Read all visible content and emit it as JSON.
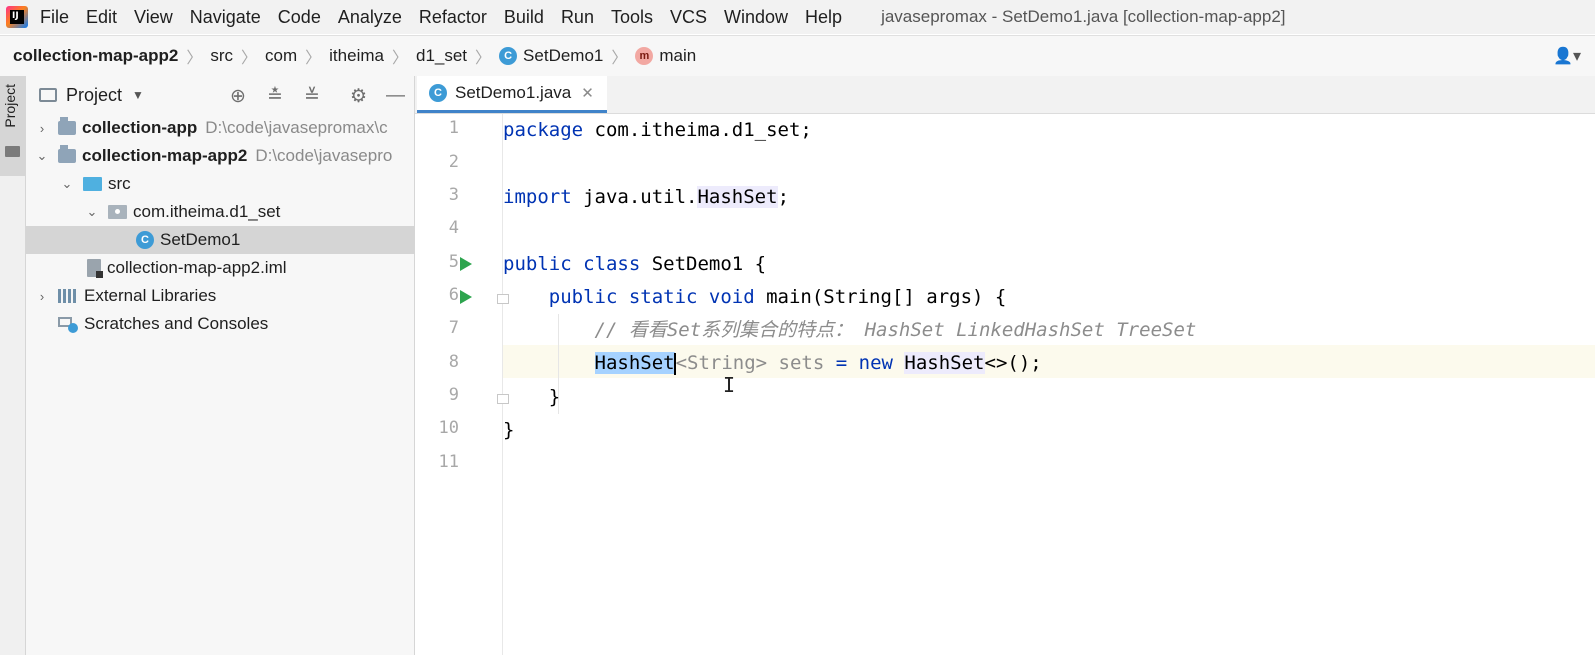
{
  "menubar": {
    "items": [
      "File",
      "Edit",
      "View",
      "Navigate",
      "Code",
      "Analyze",
      "Refactor",
      "Build",
      "Run",
      "Tools",
      "VCS",
      "Window",
      "Help"
    ],
    "window_title": "javasepromax - SetDemo1.java [collection-map-app2]"
  },
  "breadcrumb": {
    "items": [
      "collection-map-app2",
      "src",
      "com",
      "itheima",
      "d1_set",
      "SetDemo1",
      "main"
    ],
    "class_icon_letter": "C",
    "method_icon_letter": "m"
  },
  "tool_strip": {
    "project_tab": "Project"
  },
  "project_panel": {
    "title": "Project",
    "tree": [
      {
        "label": "collection-app",
        "path": "D:\\code\\javasepromax\\c",
        "bold": true,
        "expanded": false,
        "icon": "module-icon"
      },
      {
        "label": "collection-map-app2",
        "path": "D:\\code\\javasepro",
        "bold": true,
        "expanded": true,
        "icon": "module-icon"
      },
      {
        "label": "src",
        "icon": "source-folder-icon",
        "expanded": true
      },
      {
        "label": "com.itheima.d1_set",
        "icon": "package-icon",
        "expanded": true
      },
      {
        "label": "SetDemo1",
        "icon": "java-class-icon",
        "selected": true
      },
      {
        "label": "collection-map-app2.iml",
        "icon": "iml-file-icon"
      },
      {
        "label": "External Libraries",
        "icon": "library-icon",
        "expanded": false
      },
      {
        "label": "Scratches and Consoles",
        "icon": "scratches-icon"
      }
    ]
  },
  "editor": {
    "tab": {
      "label": "SetDemo1.java",
      "icon_letter": "C"
    },
    "line_numbers": [
      "1",
      "2",
      "3",
      "4",
      "5",
      "6",
      "7",
      "8",
      "9",
      "10",
      "11"
    ],
    "code": {
      "l1_kw": "package",
      "l1_rest": " com.itheima.d1_set;",
      "l3_kw": "import",
      "l3_mid": " java.util.",
      "l3_type": "HashSet",
      "l3_end": ";",
      "l5_kw": "public class",
      "l5_rest": " SetDemo1 {",
      "l6_indent": "    ",
      "l6_kw": "public static void",
      "l6_rest": " main(String[] args) {",
      "l7_indent": "        ",
      "l7_comment": "// 看看Set系列集合的特点： HashSet LinkedHashSet TreeSet",
      "l8_indent": "        ",
      "l8_sel": "HashSet",
      "l8_gen": "<String>",
      "l8_var": " sets",
      "l8_eq": " = ",
      "l8_kw": "new",
      "l8_sp": " ",
      "l8_type": "HashSet",
      "l8_end": "<>();",
      "l9": "    }",
      "l10": "}"
    },
    "current_line": 8,
    "mouse_cursor": "I"
  },
  "colors": {
    "keyword": "#0033b3",
    "comment": "#8c8c8c",
    "selection": "#a6d2ff",
    "run": "#2da44e",
    "class_icon": "#3d9bd6"
  }
}
